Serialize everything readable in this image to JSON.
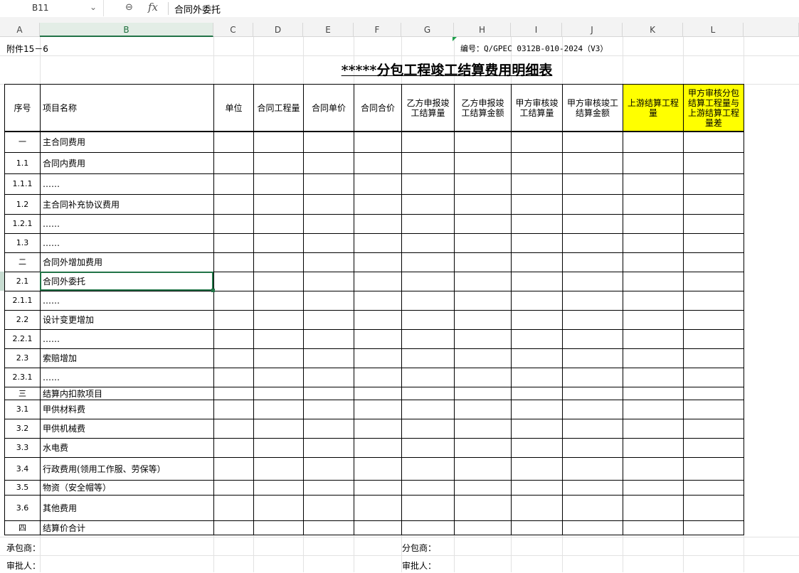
{
  "formula_bar": {
    "name_box": "B11",
    "formula": "合同外委托"
  },
  "columns": [
    "A",
    "B",
    "C",
    "D",
    "E",
    "F",
    "G",
    "H",
    "I",
    "J",
    "K",
    "L"
  ],
  "sheet": {
    "attachment": "附件15－6",
    "code": "编号：Q/GPEC 0312B-010-2024（V3）",
    "title": "*****分包工程竣工结算费用明细表",
    "headers": {
      "seq": "序号",
      "name": "项目名称",
      "unit": "单位",
      "contract_qty": "合同工程量",
      "unit_price": "合同单价",
      "total_price": "合同合价",
      "b_report_qty": "乙方申报竣工结算量",
      "b_report_amt": "乙方申报竣工结算金额",
      "a_audit_qty": "甲方审核竣工结算量",
      "a_audit_amt": "甲方审核竣工结算金额",
      "upstream_qty": "上游结算工程量",
      "diff": "甲方审核分包结算工程量与上游结算工程量差"
    },
    "rows": [
      {
        "seq": "一",
        "name": "主合同费用"
      },
      {
        "seq": "1.1",
        "name": "合同内费用"
      },
      {
        "seq": "1.1.1",
        "name": "……"
      },
      {
        "seq": "1.2",
        "name": "主合同补充协议费用"
      },
      {
        "seq": "1.2.1",
        "name": "……"
      },
      {
        "seq": "1.3",
        "name": "……"
      },
      {
        "seq": "二",
        "name": "合同外增加费用"
      },
      {
        "seq": "2.1",
        "name": "合同外委托"
      },
      {
        "seq": "2.1.1",
        "name": "……"
      },
      {
        "seq": "2.2",
        "name": "设计变更增加"
      },
      {
        "seq": "2.2.1",
        "name": "……"
      },
      {
        "seq": "2.3",
        "name": "索赔增加"
      },
      {
        "seq": "2.3.1",
        "name": "……"
      },
      {
        "seq": "三",
        "name": "结算内扣款项目"
      },
      {
        "seq": "3.1",
        "name": "甲供材料费"
      },
      {
        "seq": "3.2",
        "name": "甲供机械费"
      },
      {
        "seq": "3.3",
        "name": "水电费"
      },
      {
        "seq": "3.4",
        "name": "行政费用(领用工作服、劳保等）"
      },
      {
        "seq": "3.5",
        "name": "物资（安全帽等）"
      },
      {
        "seq": "3.6",
        "name": "其他费用"
      },
      {
        "seq": "四",
        "name": "结算价合计"
      }
    ],
    "footer": {
      "contractor": "承包商：",
      "subcontractor": "分包商：",
      "approver_left": "审批人：",
      "approver_right": "审批人："
    }
  },
  "colors": {
    "header_highlight": "#ffff00",
    "selection": "#217346"
  }
}
